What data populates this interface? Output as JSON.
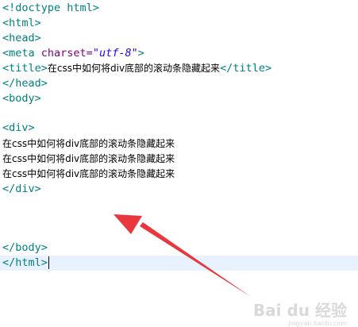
{
  "code": {
    "doctype": "<!doctype html>",
    "html_open": "<html>",
    "head_open": "<head>",
    "meta_tag_open": "<meta ",
    "meta_attr": "charset=",
    "meta_value": "\"utf-8\"",
    "meta_tag_close": ">",
    "title_open": "<title>",
    "title_text": "在css中如何将div底部的滚动条隐藏起来",
    "title_close": "</title>",
    "head_close": "</head>",
    "body_open": "<body>",
    "div_open": "<div>",
    "div_lines": [
      "在css中如何将div底部的滚动条隐藏起来",
      "在css中如何将div底部的滚动条隐藏起来",
      "在css中如何将div底部的滚动条隐藏起来"
    ],
    "div_close": "</div>",
    "body_close": "</body>",
    "html_close": "</html>"
  },
  "watermark": {
    "brand": "Bai du 经验",
    "sub": "jingyan.baidu.com"
  },
  "colors": {
    "tag": "#008080",
    "attribute": "#7f007f",
    "string": "#2a00ff",
    "arrow": "#e8383d",
    "current_line": "#e8f2fe"
  }
}
